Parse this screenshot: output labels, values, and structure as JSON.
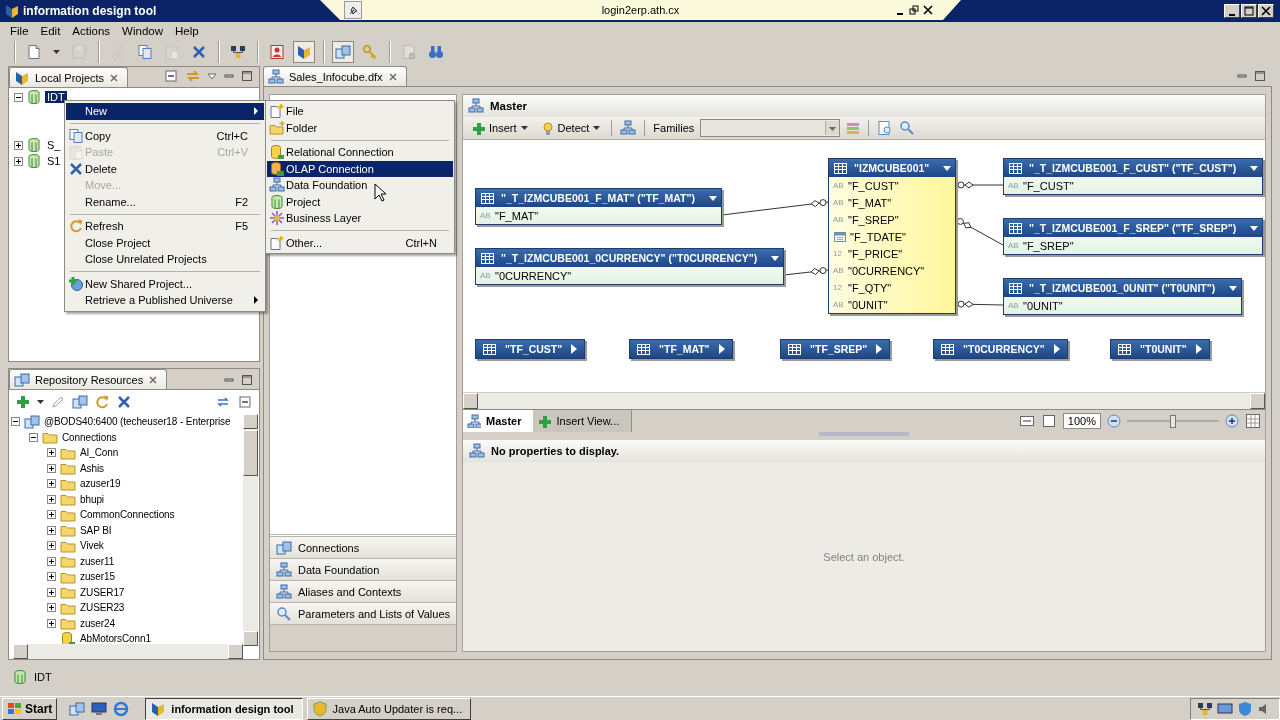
{
  "window": {
    "title": "information design tool"
  },
  "remote_bar": {
    "host": "login2erp.ath.cx"
  },
  "menu_bar": [
    "File",
    "Edit",
    "Actions",
    "Window",
    "Help"
  ],
  "toolbar": [
    [
      {
        "kind": "new",
        "disabled": false,
        "pressed": false
      },
      {
        "kind": "caret",
        "disabled": false,
        "pressed": false
      },
      {
        "kind": "save",
        "disabled": true,
        "pressed": false
      }
    ],
    [
      {
        "kind": "cut",
        "disabled": true,
        "pressed": false
      },
      {
        "kind": "copy",
        "disabled": false,
        "pressed": false
      },
      {
        "kind": "paste",
        "disabled": true,
        "pressed": false
      },
      {
        "kind": "delete",
        "disabled": false,
        "pressed": false
      }
    ],
    [
      {
        "kind": "network",
        "disabled": false,
        "pressed": false
      }
    ],
    [
      {
        "kind": "user",
        "disabled": false,
        "pressed": false
      },
      {
        "kind": "logo",
        "disabled": false,
        "pressed": true
      }
    ],
    [
      {
        "kind": "database",
        "disabled": false,
        "pressed": true
      },
      {
        "kind": "key",
        "disabled": false,
        "pressed": false
      }
    ],
    [
      {
        "kind": "check",
        "disabled": true,
        "pressed": false
      },
      {
        "kind": "binoculars",
        "disabled": false,
        "pressed": false
      }
    ]
  ],
  "local_projects": {
    "title": "Local Projects",
    "tree": [
      {
        "label": "IDT",
        "expanded": true,
        "selected": true
      },
      {
        "label": "S_",
        "expanded": false,
        "selected": false
      },
      {
        "label": "S1",
        "expanded": false,
        "selected": false
      }
    ]
  },
  "context_menu": {
    "items": [
      {
        "kind": "item",
        "label": "New",
        "disabled": false,
        "selected": true,
        "submenu": true
      },
      {
        "kind": "separator"
      },
      {
        "kind": "item",
        "label": "Copy",
        "shortcut": "Ctrl+C",
        "disabled": false,
        "selected": false,
        "submenu": false
      },
      {
        "kind": "item",
        "label": "Paste",
        "shortcut": "Ctrl+V",
        "disabled": true,
        "selected": false,
        "submenu": false
      },
      {
        "kind": "item",
        "label": "Delete",
        "disabled": false,
        "selected": false,
        "submenu": false
      },
      {
        "kind": "item",
        "label": "Move...",
        "disabled": true,
        "selected": false,
        "submenu": false
      },
      {
        "kind": "item",
        "label": "Rename...",
        "shortcut": "F2",
        "disabled": false,
        "selected": false,
        "submenu": false
      },
      {
        "kind": "separator"
      },
      {
        "kind": "item",
        "label": "Refresh",
        "shortcut": "F5",
        "disabled": false,
        "selected": false,
        "submenu": false
      },
      {
        "kind": "item",
        "label": "Close Project",
        "disabled": false,
        "selected": false,
        "submenu": false
      },
      {
        "kind": "item",
        "label": "Close Unrelated Projects",
        "disabled": false,
        "selected": false,
        "submenu": false
      },
      {
        "kind": "separator"
      },
      {
        "kind": "item",
        "label": "New Shared Project...",
        "disabled": false,
        "selected": false,
        "submenu": false
      },
      {
        "kind": "item",
        "label": "Retrieve a Published Universe",
        "disabled": false,
        "selected": false,
        "submenu": true
      }
    ]
  },
  "new_submenu": {
    "items": [
      {
        "kind": "item",
        "label": "File",
        "disabled": false,
        "selected": false
      },
      {
        "kind": "item",
        "label": "Folder",
        "disabled": false,
        "selected": false
      },
      {
        "kind": "separator"
      },
      {
        "kind": "item",
        "label": "Relational Connection",
        "disabled": false,
        "selected": false
      },
      {
        "kind": "item",
        "label": "OLAP Connection",
        "disabled": false,
        "selected": true
      },
      {
        "kind": "item",
        "label": "Data Foundation",
        "disabled": false,
        "selected": false
      },
      {
        "kind": "item",
        "label": "Project",
        "disabled": false,
        "selected": false
      },
      {
        "kind": "item",
        "label": "Business Layer",
        "disabled": false,
        "selected": false
      },
      {
        "kind": "separator"
      },
      {
        "kind": "item",
        "label": "Other...",
        "shortcut": "Ctrl+N",
        "disabled": false,
        "selected": false
      }
    ]
  },
  "repository": {
    "title": "Repository Resources",
    "tree": [
      {
        "kind": "server",
        "label": "@BODS40:6400 (techeuser18 - Enterprise",
        "expanded": true,
        "children": [
          {
            "kind": "folder",
            "label": "Connections",
            "expanded": true,
            "children": [
              {
                "kind": "folder",
                "label": "AI_Conn",
                "expanded": false
              },
              {
                "kind": "folder",
                "label": "Ashis",
                "expanded": false
              },
              {
                "kind": "folder",
                "label": "azuser19",
                "expanded": false
              },
              {
                "kind": "folder",
                "label": "bhupi",
                "expanded": false
              },
              {
                "kind": "folder",
                "label": "CommonConnections",
                "expanded": false
              },
              {
                "kind": "folder",
                "label": "SAP BI",
                "expanded": false
              },
              {
                "kind": "folder",
                "label": "Vivek",
                "expanded": false
              },
              {
                "kind": "folder",
                "label": "zuser11",
                "expanded": false
              },
              {
                "kind": "folder",
                "label": "zuser15",
                "expanded": false
              },
              {
                "kind": "folder",
                "label": "ZUSER17",
                "expanded": false
              },
              {
                "kind": "folder",
                "label": "ZUSER23",
                "expanded": false
              },
              {
                "kind": "folder",
                "label": "zuser24",
                "expanded": false
              },
              {
                "kind": "connection",
                "label": "AbMotorsConn1"
              }
            ]
          }
        ]
      }
    ]
  },
  "editor": {
    "tab": "Sales_Infocube.dfx",
    "sections": [
      "Connections",
      "Data Foundation",
      "Aliases and Contexts",
      "Parameters and Lists of Values"
    ],
    "master": {
      "title": "Master",
      "insert": "Insert",
      "detect": "Detect",
      "families_label": "Families",
      "tables": [
        {
          "kind": "dimension",
          "name": "\"_T_IZMCUBE001_F_MAT\" (\"TF_MAT\")",
          "columns": [
            {
              "kind": "text",
              "type_label": "AB",
              "name": "\"F_MAT\""
            }
          ]
        },
        {
          "kind": "dimension",
          "name": "\"_T_IZMCUBE001_0CURRENCY\" (\"T0CURRENCY\")",
          "columns": [
            {
              "kind": "text",
              "type_label": "AB",
              "name": "\"0CURRENCY\""
            }
          ]
        },
        {
          "kind": "fact",
          "name": "\"IZMCUBE001\"",
          "columns": [
            {
              "kind": "text",
              "type_label": "AB",
              "name": "\"F_CUST\""
            },
            {
              "kind": "text",
              "type_label": "AB",
              "name": "\"F_MAT\""
            },
            {
              "kind": "text",
              "type_label": "AB",
              "name": "\"F_SREP\""
            },
            {
              "kind": "date",
              "name": "\"F_TDATE\""
            },
            {
              "kind": "number",
              "type_label": "12",
              "name": "\"F_PRICE\""
            },
            {
              "kind": "text",
              "type_label": "AB",
              "name": "\"0CURRENCY\""
            },
            {
              "kind": "number",
              "type_label": "12",
              "name": "\"F_QTY\""
            },
            {
              "kind": "text",
              "type_label": "AB",
              "name": "\"0UNIT\""
            }
          ]
        },
        {
          "kind": "dimension",
          "name": "\"_T_IZMCUBE001_F_CUST\" (\"TF_CUST\")",
          "columns": [
            {
              "kind": "text",
              "type_label": "AB",
              "name": "\"F_CUST\""
            }
          ]
        },
        {
          "kind": "dimension",
          "name": "\"_T_IZMCUBE001_F_SREP\" (\"TF_SREP\")",
          "columns": [
            {
              "kind": "text",
              "type_label": "AB",
              "name": "\"F_SREP\""
            }
          ]
        },
        {
          "kind": "dimension",
          "name": "\"_T_IZMCUBE001_0UNIT\" (\"T0UNIT\")",
          "columns": [
            {
              "kind": "text",
              "type_label": "AB",
              "name": "\"0UNIT\""
            }
          ]
        }
      ],
      "aliases": [
        "\"TF_CUST\"",
        "\"TF_MAT\"",
        "\"TF_SREP\"",
        "\"T0CURRENCY\"",
        "\"T0UNIT\""
      ],
      "view_tabs": [
        {
          "label": "Master",
          "selected": true
        },
        {
          "label": "Insert View...",
          "selected": false
        }
      ],
      "zoom": {
        "value": "100%",
        "level": 0.5
      }
    },
    "properties": {
      "message": "No properties to display.",
      "hint": "Select an object."
    }
  },
  "status_bar": {
    "label": "IDT"
  },
  "taskbar": {
    "start": "Start",
    "tasks": [
      {
        "label": "information design tool",
        "selected": true
      },
      {
        "label": "Java Auto Updater is req...",
        "selected": false
      }
    ]
  }
}
